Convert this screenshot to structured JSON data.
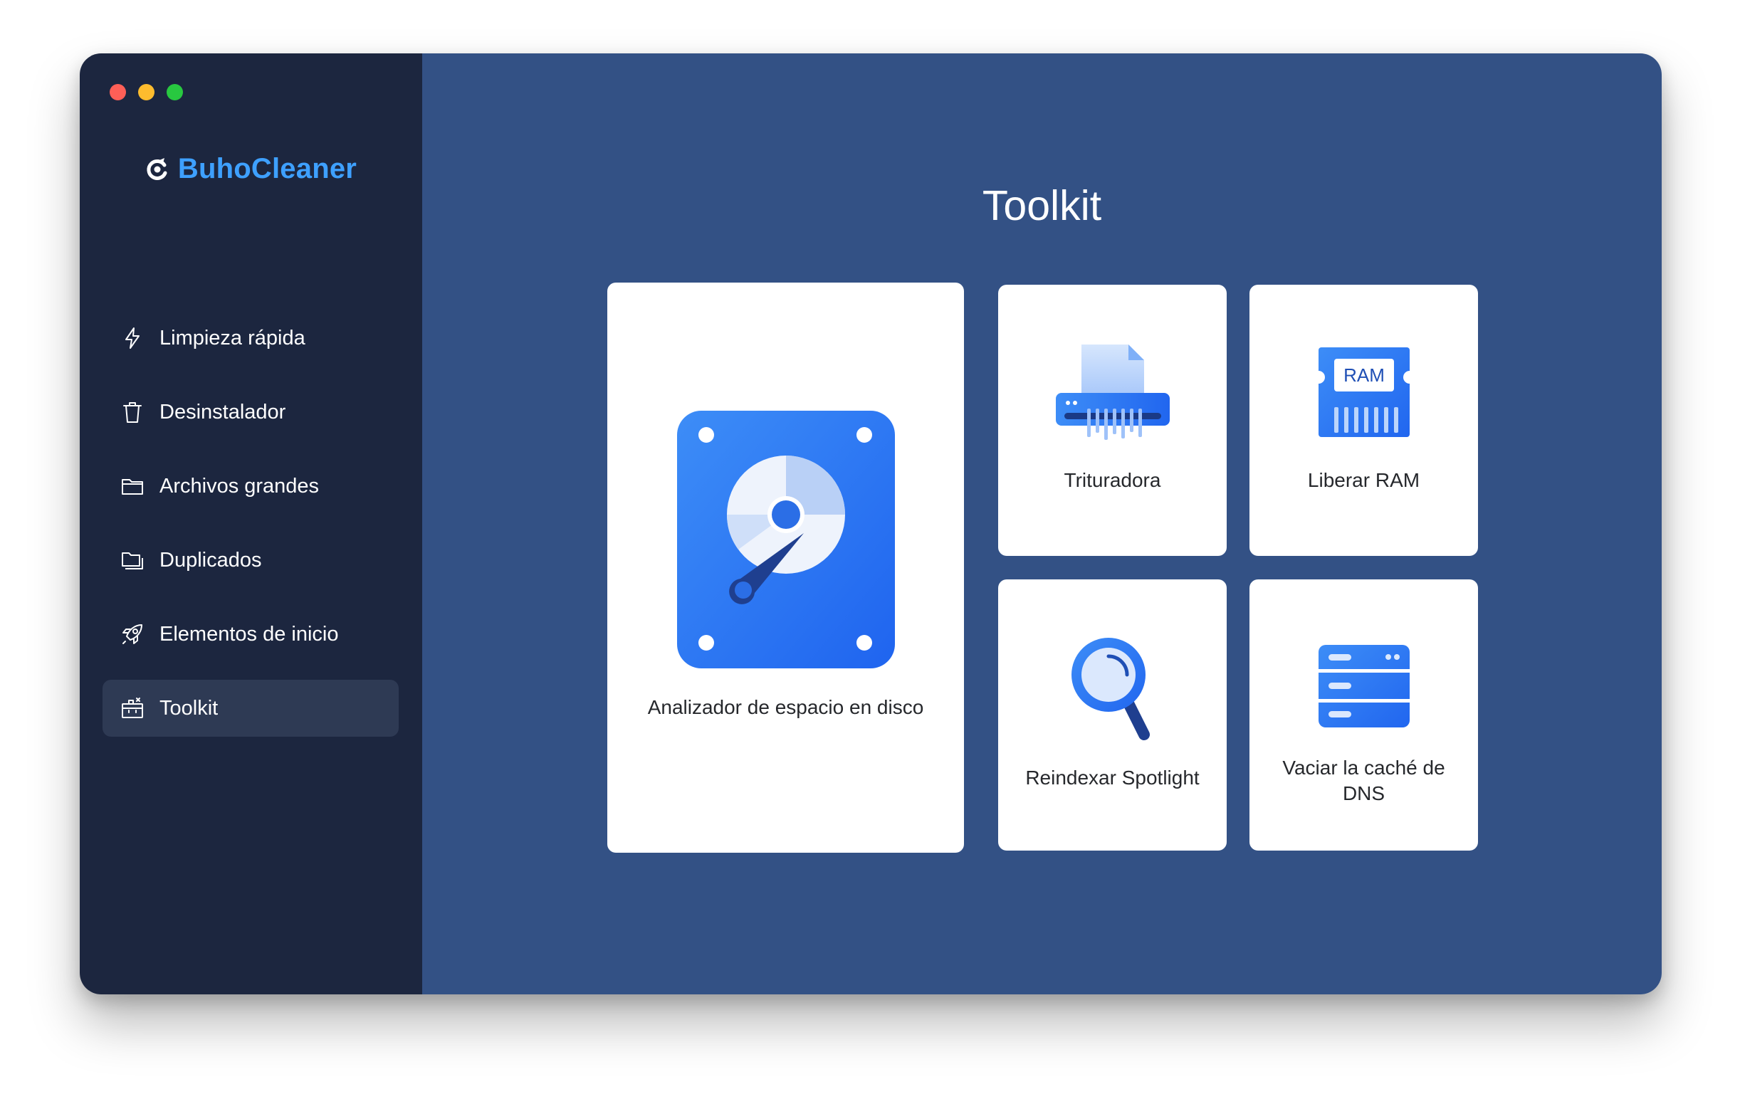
{
  "app": {
    "brand": "BuhoCleaner"
  },
  "sidebar": {
    "items": [
      {
        "label": "Limpieza rápida",
        "icon": "bolt-icon",
        "active": false
      },
      {
        "label": "Desinstalador",
        "icon": "trash-icon",
        "active": false
      },
      {
        "label": "Archivos grandes",
        "icon": "folder-icon",
        "active": false
      },
      {
        "label": "Duplicados",
        "icon": "duplicate-folder-icon",
        "active": false
      },
      {
        "label": "Elementos de inicio",
        "icon": "rocket-icon",
        "active": false
      },
      {
        "label": "Toolkit",
        "icon": "toolkit-icon",
        "active": true
      }
    ]
  },
  "main": {
    "title": "Toolkit",
    "tools": [
      {
        "label": "Analizador de espacio en disco",
        "icon": "disk-analyzer-icon"
      },
      {
        "label": "Trituradora",
        "icon": "shredder-icon"
      },
      {
        "label": "Liberar RAM",
        "icon": "ram-icon",
        "icon_text": "RAM"
      },
      {
        "label": "Reindexar Spotlight",
        "icon": "magnifier-icon"
      },
      {
        "label": "Vaciar la caché de DNS",
        "icon": "server-icon"
      }
    ]
  },
  "colors": {
    "sidebar_bg": "#1c263f",
    "main_bg": "#335185",
    "brand": "#3ea0ff",
    "active_item_bg": "#2e3a54",
    "card_bg": "#ffffff",
    "icon_blue": "#2b77f0"
  }
}
